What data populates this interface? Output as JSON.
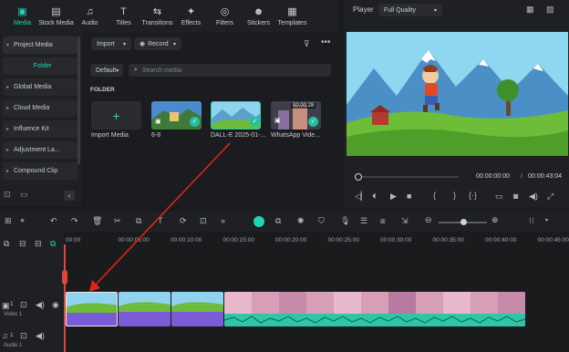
{
  "toolbar": {
    "items": [
      {
        "label": "Media",
        "icon": "media-icon",
        "glyph": "▣"
      },
      {
        "label": "Stock Media",
        "icon": "stock-media-icon",
        "glyph": "▤"
      },
      {
        "label": "Audio",
        "icon": "audio-icon",
        "glyph": "♫"
      },
      {
        "label": "Titles",
        "icon": "titles-icon",
        "glyph": "T"
      },
      {
        "label": "Transitions",
        "icon": "transitions-icon",
        "glyph": "⇆"
      },
      {
        "label": "Effects",
        "icon": "effects-icon",
        "glyph": "✦"
      },
      {
        "label": "Filters",
        "icon": "filters-icon",
        "glyph": "◎"
      },
      {
        "label": "Stickers",
        "icon": "stickers-icon",
        "glyph": "☻"
      },
      {
        "label": "Templates",
        "icon": "templates-icon",
        "glyph": "▦"
      }
    ],
    "active_index": 0
  },
  "sidebar": {
    "items": [
      {
        "label": "Project Media"
      },
      {
        "label": "Folder"
      },
      {
        "label": "Global Media"
      },
      {
        "label": "Cloud Media"
      },
      {
        "label": "Influence Kit"
      },
      {
        "label": "Adjustment La..."
      },
      {
        "label": "Compound Clip"
      }
    ]
  },
  "media": {
    "import_label": "Import",
    "record_label": "Record",
    "sort_label": "Default",
    "search_placeholder": "Search media",
    "section_title": "FOLDER",
    "items": [
      {
        "name": "Import Media"
      },
      {
        "name": "6-8"
      },
      {
        "name": "DALL-E 2025-01-..."
      },
      {
        "name": "WhatsApp Vide...",
        "duration": "00:00:28"
      }
    ]
  },
  "player": {
    "title": "Player",
    "quality": "Full Quality",
    "current_time": "00:00:00:00",
    "separator": "/",
    "total_time": "00:00:43:04"
  },
  "timeline": {
    "ticks": [
      "00:00",
      "00:00:05:00",
      "00:00:10:00",
      "00:00:15:00",
      "00:00:20:00",
      "00:00:25:00",
      "00:00:30:00",
      "00:00:35:00",
      "00:00:40:00",
      "00:00:45:00"
    ],
    "video_track_label": "Video 1",
    "audio_track_label": "Audio 1",
    "video_track_num": "1",
    "audio_track_num": "1"
  },
  "colors": {
    "accent": "#22d3b6",
    "clip_purple": "#7b5bd6",
    "audio_teal": "#2fc6a8",
    "arrow": "#e2231a",
    "playhead": "#e0443a"
  }
}
